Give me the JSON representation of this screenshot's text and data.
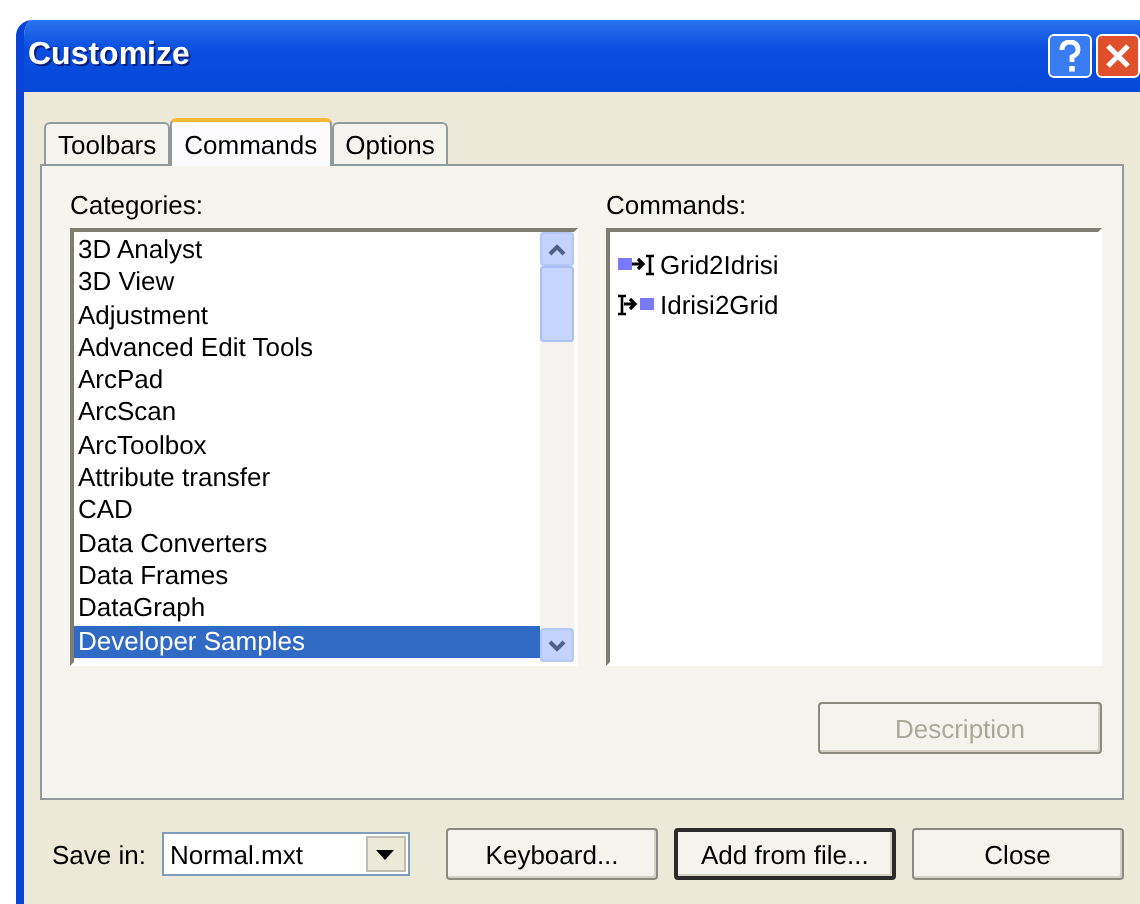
{
  "window": {
    "title": "Customize"
  },
  "tabs": [
    {
      "label": "Toolbars",
      "selected": false
    },
    {
      "label": "Commands",
      "selected": true
    },
    {
      "label": "Options",
      "selected": false
    }
  ],
  "categories": {
    "label": "Categories:",
    "items": [
      {
        "label": "3D Analyst",
        "selected": false
      },
      {
        "label": "3D View",
        "selected": false
      },
      {
        "label": "Adjustment",
        "selected": false
      },
      {
        "label": "Advanced Edit Tools",
        "selected": false
      },
      {
        "label": "ArcPad",
        "selected": false
      },
      {
        "label": "ArcScan",
        "selected": false
      },
      {
        "label": "ArcToolbox",
        "selected": false
      },
      {
        "label": "Attribute transfer",
        "selected": false
      },
      {
        "label": "CAD",
        "selected": false
      },
      {
        "label": "Data Converters",
        "selected": false
      },
      {
        "label": "Data Frames",
        "selected": false
      },
      {
        "label": "DataGraph",
        "selected": false
      },
      {
        "label": "Developer Samples",
        "selected": true
      }
    ]
  },
  "commands": {
    "label": "Commands:",
    "items": [
      {
        "label": "Grid2Idrisi",
        "kind": "to-idrisi"
      },
      {
        "label": "Idrisi2Grid",
        "kind": "to-grid"
      }
    ]
  },
  "description_button": {
    "label": "Description",
    "disabled": true
  },
  "save_in": {
    "label": "Save in:",
    "value": "Normal.mxt"
  },
  "buttons": [
    {
      "label": "Keyboard...",
      "default": false
    },
    {
      "label": "Add from file...",
      "default": true
    },
    {
      "label": "Close",
      "default": false
    }
  ]
}
